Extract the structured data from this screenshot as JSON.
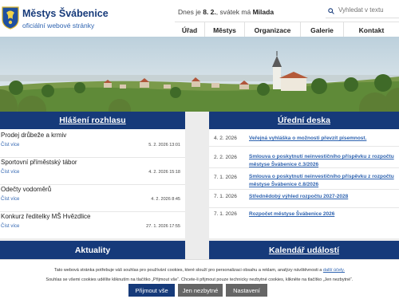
{
  "header": {
    "title": "Městys Švábenice",
    "subtitle": "oficiální webové stránky",
    "date_prefix": "Dnes je",
    "date_value": "8. 2.",
    "date_mid": ", svátek má",
    "name_day": "Milada",
    "search_placeholder": "Vyhledat v textu"
  },
  "nav": [
    {
      "label": "Úřad"
    },
    {
      "label": "Městys"
    },
    {
      "label": "Organizace"
    },
    {
      "label": "Galerie"
    },
    {
      "label": "Kontakt"
    }
  ],
  "announcements": {
    "heading": "Hlášení rozhlasu",
    "items": [
      {
        "title": "Prodej drůbeže a krmiv",
        "more": "Číst více",
        "date": "5. 2. 2026 13:01"
      },
      {
        "title": "Sportovní příměstský tábor",
        "more": "Číst více",
        "date": "4. 2. 2026 15:18"
      },
      {
        "title": "Odečty vodoměrů",
        "more": "Číst více",
        "date": "4. 2. 2026 8:45"
      },
      {
        "title": "Konkurz ředitelky MŠ Hvězdlice",
        "more": "Číst více",
        "date": "27. 1. 2026 17:55"
      }
    ]
  },
  "board": {
    "heading": "Úřední deska",
    "items": [
      {
        "date": "4. 2. 2026",
        "title": "Veřejná vyhláška o možnosti převzít písemnost."
      },
      {
        "date": "2. 2. 2026",
        "title": "Smlouva o poskytnutí neinvestičního příspěvku z rozpočtu městyse Švábenice č.3/2026"
      },
      {
        "date": "7. 1. 2026",
        "title": "Smlouva o poskytnutí neinvestičního příspěvku z rozpočtu městyse Švábenice č.8/2026"
      },
      {
        "date": "7. 1. 2026",
        "title": "Střednědobý výhled rozpočtu 2027-2028"
      },
      {
        "date": "7. 1. 2026",
        "title": "Rozpočet městyse Švábenice 2026"
      }
    ]
  },
  "news_heading": "Aktuality",
  "calendar_heading": "Kalendář událostí",
  "cookie": {
    "text1": "Tato webová stránka potřebuje váš souhlas pro používání cookies, které slouží pro personalizaci obsahu a reklam, analýzy návštěvnosti a",
    "link": "další účely.",
    "text2": "Souhlas se všemi cookies udělíte kliknutím na tlačítko „Přijmout vše“. Chcete-li přijmout pouze technicky nezbytné cookies, klikněte na tlačítko „Jen nezbytné“.",
    "accept": "Přijmout vše",
    "necessary": "Jen nezbytné",
    "settings": "Nastavení"
  },
  "colors": {
    "primary": "#163a7a",
    "link": "#2e63b0",
    "button_gray": "#666666"
  }
}
